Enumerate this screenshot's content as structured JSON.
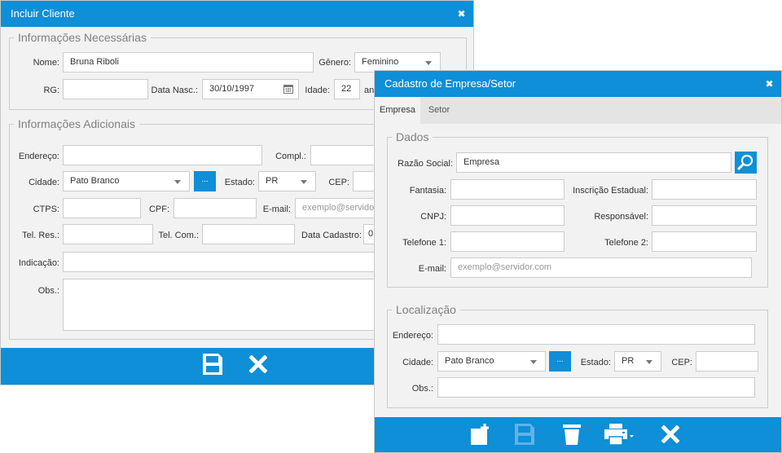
{
  "incluir": {
    "title": "Incluir Cliente",
    "close_glyph": "✖",
    "section1": "Informações Necessárias",
    "section2": "Informações Adicionais",
    "labels": {
      "nome": "Nome:",
      "genero": "Gênero:",
      "rg": "RG:",
      "data_nasc": "Data Nasc.:",
      "idade": "Idade:",
      "endereco": "Endereço:",
      "compl": "Compl.:",
      "cidade": "Cidade:",
      "estado": "Estado:",
      "cep": "CEP:",
      "ctps": "CTPS:",
      "cpf": "CPF:",
      "email": "E-mail:",
      "tel_res": "Tel. Res.:",
      "tel_com": "Tel. Com.:",
      "data_cadastro": "Data Cadastro:",
      "indicacao": "Indicação:",
      "obs": "Obs.:"
    },
    "values": {
      "nome": "Bruna Riboli",
      "genero": "Feminino",
      "data_nasc": "30/10/1997",
      "idade": "22",
      "idade_suffix": "an",
      "cidade": "Pato Branco",
      "estado": "PR",
      "email_placeholder": "exemplo@servidor.",
      "data_cadastro": "0"
    },
    "dots_label": "...",
    "footer_icons": [
      "save-icon",
      "close-icon"
    ]
  },
  "cadastro": {
    "title": "Cadastro de Empresa/Setor",
    "close_glyph": "✖",
    "tabs": [
      {
        "label": "Empresa",
        "active": true
      },
      {
        "label": "Setor",
        "active": false
      }
    ],
    "section_dados": "Dados",
    "section_local": "Localização",
    "labels": {
      "razao_social": "Razão Social:",
      "fantasia": "Fantasia:",
      "inscricao": "Inscrição Estadual:",
      "cnpj": "CNPJ:",
      "responsavel": "Responsável:",
      "telefone1": "Telefone 1:",
      "telefone2": "Telefone 2:",
      "email": "E-mail:",
      "endereco": "Endereço:",
      "cidade": "Cidade:",
      "estado": "Estado:",
      "cep": "CEP:",
      "obs": "Obs.:"
    },
    "values": {
      "razao_social": "Empresa",
      "email_placeholder": "exemplo@servidor.com",
      "cidade": "Pato Branco",
      "estado": "PR"
    },
    "dots_label": "...",
    "footer_icons": [
      "new-document-icon",
      "save-icon",
      "trash-icon",
      "print-icon",
      "close-icon"
    ]
  },
  "colors": {
    "accent": "#0e8fd7",
    "window_bg": "#f2f2f2",
    "border": "#cccccc",
    "save_disabled": "#5fb3e6"
  }
}
